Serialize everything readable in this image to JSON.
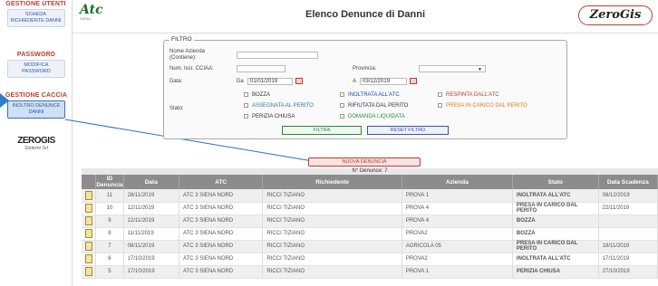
{
  "sidebar": {
    "section1_title": "GESTIONE UTENTI",
    "section1_btn": "SCHEDA RICHIEDENTE DANNI",
    "section2_title": "PASSWORD",
    "section2_btn": "MODIFICA PASSWORD",
    "section3_title": "GESTIONE CACCIA",
    "section3_btn": "INOLTRO DENUNCE DANNI",
    "company_logo": "ZEROGIS",
    "company_sub": "Sistemi Srl"
  },
  "header": {
    "logo_text": "Atc",
    "logo_sub": "SIENA",
    "title": "Elenco Denunce di Danni",
    "right_logo": "ZeroGis"
  },
  "filter": {
    "legend": "Filtro",
    "nome_azienda_label": "Nome Azienda (Contiene):",
    "nome_azienda_value": "",
    "cciaa_label": "Num. Iscr. CCIAA:",
    "cciaa_value": "",
    "provincia_label": "Provincia:",
    "provincia_value": "",
    "data_label": "Data:",
    "da_label": "Da",
    "da_value": "01/01/2019",
    "a_label": "A",
    "a_value": "03/12/2019",
    "stato_label": "Stato:",
    "states": [
      {
        "label": "BOZZA",
        "color": "#333333"
      },
      {
        "label": "INOLTRATA ALL'ATC",
        "color": "#1f3fb0"
      },
      {
        "label": "RESPINTA DALL'ATC",
        "color": "#c0392b"
      },
      {
        "label": "ASSEGNATA AL PERITO",
        "color": "#2b7aa0"
      },
      {
        "label": "RIFIUTATA DAL PERITO",
        "color": "#333333"
      },
      {
        "label": "PRESA IN CARICO DAL PERITO",
        "color": "#e07b17"
      },
      {
        "label": "PERIZIA CHIUSA",
        "color": "#333333"
      },
      {
        "label": "DOMANDA LIQUIDATA",
        "color": "#2a8a3e"
      }
    ],
    "filtra_label": "Filtra",
    "reset_label": "Reset Filtro"
  },
  "nuova_denuncia_label": "Nuova Denuncia",
  "count_label": "N° Denunce: 7",
  "table": {
    "headers": [
      "",
      "ID Denuncia",
      "Data",
      "ATC",
      "Richiedente",
      "Azienda",
      "Stato",
      "Data Scadenza"
    ],
    "rows": [
      {
        "id": "11",
        "data": "28/11/2019",
        "atc": "ATC 3 SIENA NORD",
        "richiedente": "RICCI TIZIANO",
        "azienda": "PROVA 1",
        "stato": "INOLTRATA ALL'ATC",
        "stato_class": "st-inoltrata",
        "scadenza": "08/12/2019"
      },
      {
        "id": "10",
        "data": "12/11/2019",
        "atc": "ATC 3 SIENA NORD",
        "richiedente": "RICCI TIZIANO",
        "azienda": "PROVA 4",
        "stato": "PRESA IN CARICO DAL PERITO",
        "stato_class": "st-presa",
        "scadenza": "22/11/2019"
      },
      {
        "id": "9",
        "data": "12/11/2019",
        "atc": "ATC 3 SIENA NORD",
        "richiedente": "RICCI TIZIANO",
        "azienda": "PROVA 4",
        "stato": "BOZZA",
        "stato_class": "st-bozza",
        "scadenza": ""
      },
      {
        "id": "8",
        "data": "11/11/2019",
        "atc": "ATC 3 SIENA NORD",
        "richiedente": "RICCI TIZIANO",
        "azienda": "PROVA2",
        "stato": "BOZZA",
        "stato_class": "st-bozza",
        "scadenza": ""
      },
      {
        "id": "7",
        "data": "08/11/2019",
        "atc": "ATC 3 SIENA NORD",
        "richiedente": "RICCI TIZIANO",
        "azienda": "AGRICOLA 05",
        "stato": "PRESA IN CARICO DAL PERITO",
        "stato_class": "st-presa",
        "scadenza": "18/11/2019"
      },
      {
        "id": "6",
        "data": "17/10/2019",
        "atc": "ATC 3 SIENA NORD",
        "richiedente": "RICCI TIZIANO",
        "azienda": "PROVA2",
        "stato": "INOLTRATA ALL'ATC",
        "stato_class": "st-inoltrata",
        "scadenza": "17/11/2019"
      },
      {
        "id": "5",
        "data": "17/10/2019",
        "atc": "ATC 3 SIENA NORD",
        "richiedente": "RICCI TIZIANO",
        "azienda": "PROVA 1",
        "stato": "PERIZIA CHIUSA",
        "stato_class": "st-perizia",
        "scadenza": "27/10/2019"
      }
    ]
  }
}
